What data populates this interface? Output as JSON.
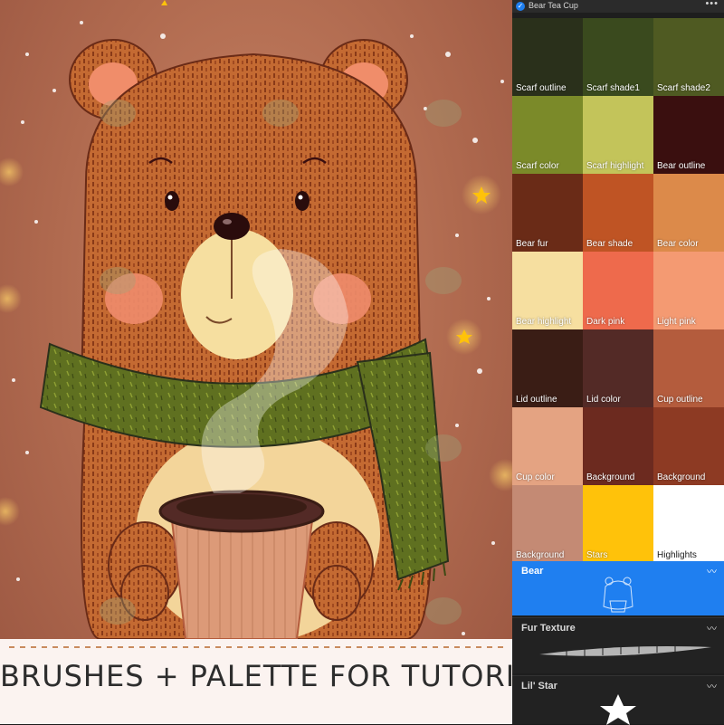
{
  "banner": {
    "text": "BRUSHES + PALETTE FOR TUTORIAL"
  },
  "palette": {
    "title": "Bear Tea Cup",
    "more_icon": "more-icon",
    "swatches": [
      {
        "label": "Scarf outline",
        "color": "#2a301b"
      },
      {
        "label": "Scarf shade1",
        "color": "#3a4a1e"
      },
      {
        "label": "Scarf shade2",
        "color": "#4f5a22"
      },
      {
        "label": "Scarf color",
        "color": "#7b8a29"
      },
      {
        "label": "Scarf highlight",
        "color": "#c3c45a"
      },
      {
        "label": "Bear outline",
        "color": "#3a0f0f"
      },
      {
        "label": "Bear fur",
        "color": "#6a2b17"
      },
      {
        "label": "Bear shade",
        "color": "#bf5424"
      },
      {
        "label": "Bear color",
        "color": "#dc8a4a"
      },
      {
        "label": "Bear highlight",
        "color": "#f6dfa0"
      },
      {
        "label": "Dark pink",
        "color": "#ee6a4c"
      },
      {
        "label": "Light pink",
        "color": "#f49a72"
      },
      {
        "label": "Lid outline",
        "color": "#3a1d15"
      },
      {
        "label": "Lid color",
        "color": "#532a26"
      },
      {
        "label": "Cup outline",
        "color": "#b45c3d"
      },
      {
        "label": "Cup color",
        "color": "#e4a382"
      },
      {
        "label": "Background",
        "color": "#6c2a1f"
      },
      {
        "label": "Background",
        "color": "#8d3a23"
      },
      {
        "label": "Background",
        "color": "#c48a74"
      },
      {
        "label": "Stars",
        "color": "#ffc20a"
      },
      {
        "label": "Highlights",
        "color": "#ffffff"
      }
    ]
  },
  "brushes": [
    {
      "name": "Bear",
      "selected": true,
      "edit_icon": "edit-icon"
    },
    {
      "name": "Fur Texture",
      "selected": false,
      "edit_icon": "edit-icon"
    },
    {
      "name": "Lil' Star",
      "selected": false,
      "edit_icon": "edit-icon"
    }
  ]
}
